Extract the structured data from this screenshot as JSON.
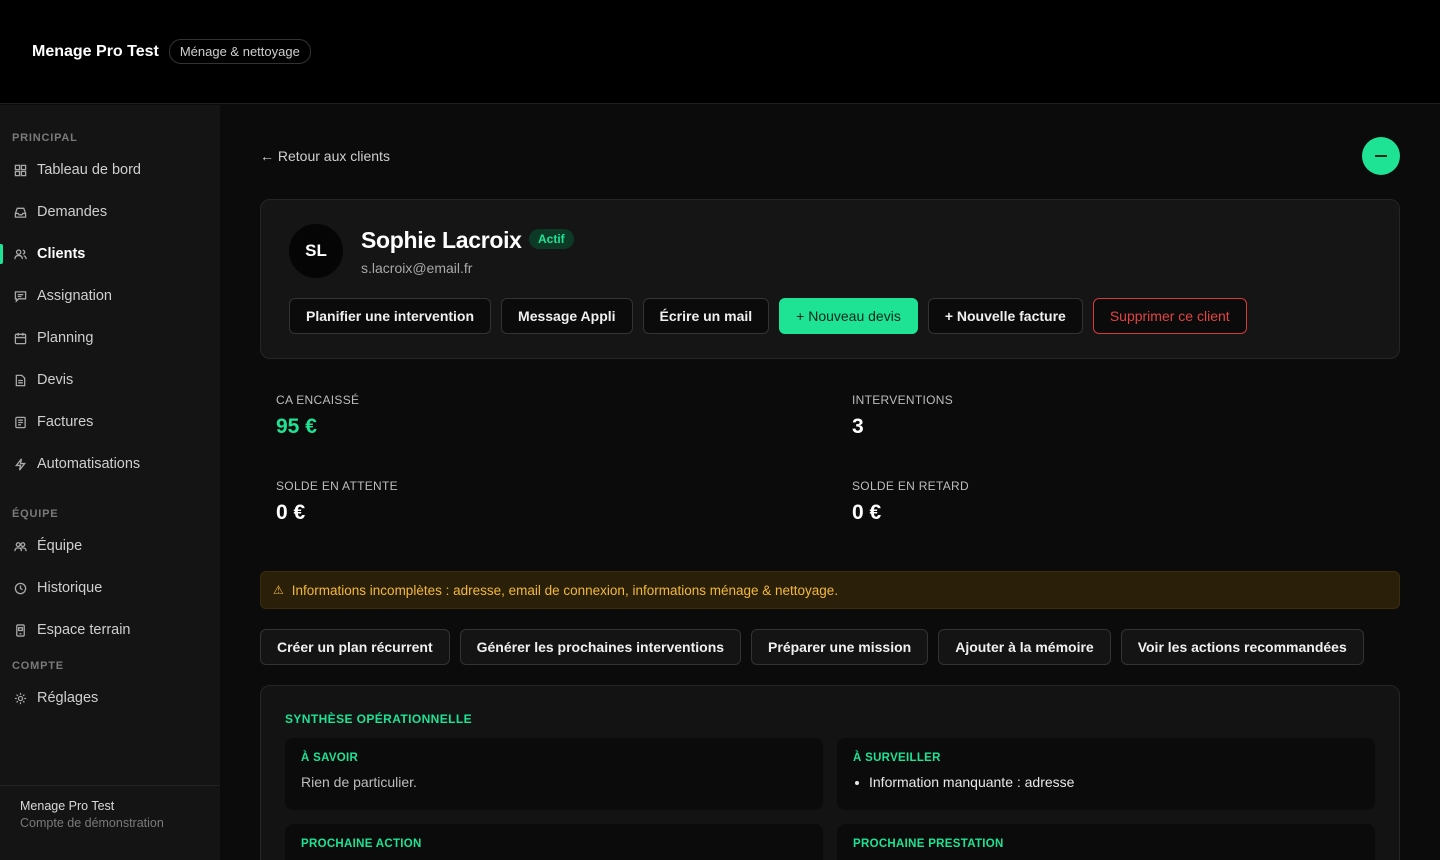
{
  "header": {
    "brand": "Menage Pro Test",
    "tag": "Ménage & nettoyage"
  },
  "sidebar": {
    "sections": {
      "principal": "PRINCIPAL",
      "equipe": "ÉQUIPE",
      "compte": "COMPTE"
    },
    "items": [
      {
        "label": "Tableau de bord",
        "icon": "grid-icon"
      },
      {
        "label": "Demandes",
        "icon": "inbox-icon"
      },
      {
        "label": "Clients",
        "icon": "users-icon",
        "active": true
      },
      {
        "label": "Assignation",
        "icon": "message-icon"
      },
      {
        "label": "Planning",
        "icon": "calendar-icon"
      },
      {
        "label": "Devis",
        "icon": "document-icon"
      },
      {
        "label": "Factures",
        "icon": "invoice-icon"
      },
      {
        "label": "Automatisations",
        "icon": "bolt-icon"
      },
      {
        "label": "Équipe",
        "icon": "team-icon"
      },
      {
        "label": "Historique",
        "icon": "clock-icon"
      },
      {
        "label": "Espace terrain",
        "icon": "phone-icon"
      },
      {
        "label": "Réglages",
        "icon": "gear-icon"
      }
    ],
    "footer": {
      "name": "Menage Pro Test",
      "subtitle": "Compte de démonstration"
    }
  },
  "main": {
    "back_link": "← Retour aux clients",
    "client": {
      "initials": "SL",
      "name": "Sophie Lacroix",
      "status": "Actif",
      "email": "s.lacroix@email.fr"
    },
    "actions": {
      "plan": "Planifier une intervention",
      "message": "Message Appli",
      "mail": "Écrire un mail",
      "new_quote": "+ Nouveau devis",
      "new_invoice": "+ Nouvelle facture",
      "delete": "Supprimer ce client"
    },
    "stats": {
      "ca_label": "CA ENCAISSÉ",
      "ca_value": "95 €",
      "interventions_label": "INTERVENTIONS",
      "interventions_value": "3",
      "pending_label": "SOLDE EN ATTENTE",
      "pending_value": "0 €",
      "late_label": "SOLDE EN RETARD",
      "late_value": "0 €"
    },
    "warning": "Informations incomplètes : adresse, email de connexion, informations ménage & nettoyage.",
    "quick_actions": {
      "recurring": "Créer un plan récurrent",
      "generate": "Générer les prochaines interventions",
      "mission": "Préparer une mission",
      "memory": "Ajouter à la mémoire",
      "recommended": "Voir les actions recommandées"
    },
    "synthesis": {
      "title": "SYNTHÈSE OPÉRATIONNELLE",
      "know_title": "À SAVOIR",
      "know_text": "Rien de particulier.",
      "watch_title": "À SURVEILLER",
      "watch_items": [
        "Information manquante : adresse"
      ],
      "next_action_title": "PROCHAINE ACTION",
      "next_service_title": "PROCHAINE PRESTATION"
    }
  },
  "colors": {
    "accent": "#1ee394",
    "danger": "#e04444",
    "warning": "#f3b93a"
  }
}
